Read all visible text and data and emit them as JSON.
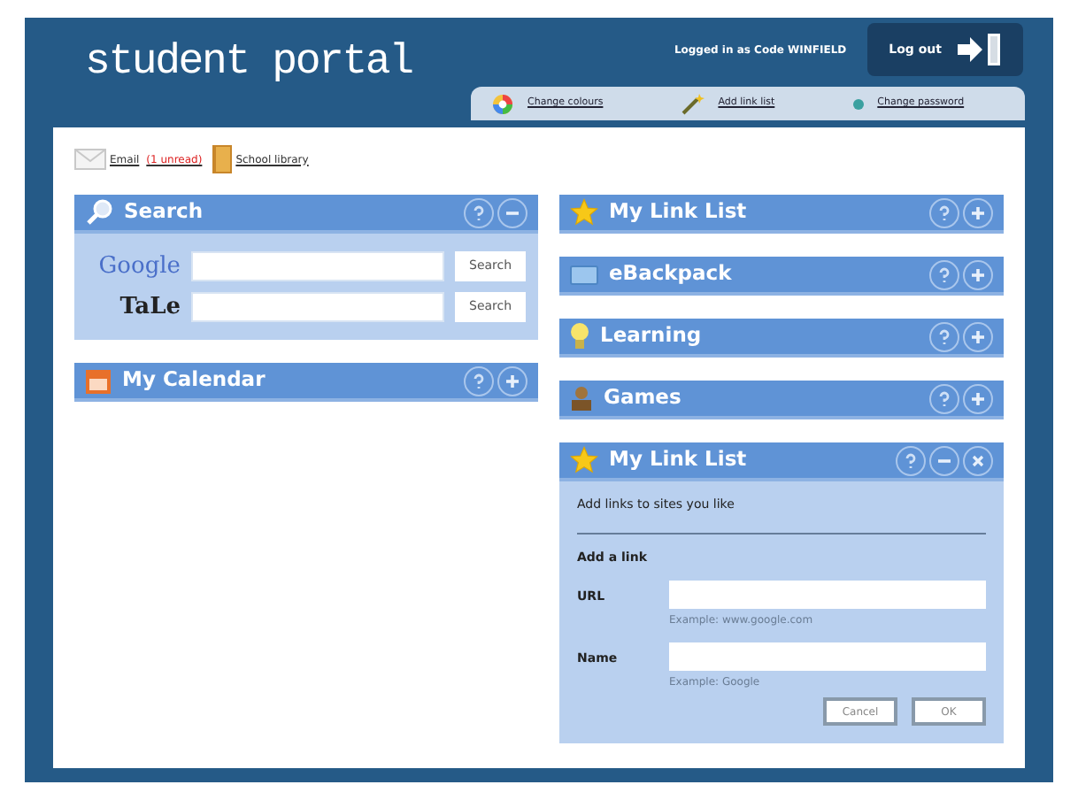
{
  "header": {
    "title": "student portal",
    "logged_in": "Logged in as Code WINFIELD",
    "logout": "Log out"
  },
  "tabs": [
    {
      "label": "Change colours"
    },
    {
      "label": "Add link list"
    },
    {
      "label": "Change password"
    }
  ],
  "quick_links": [
    {
      "label": "Email",
      "badge": "(1 unread)"
    },
    {
      "label": "School library"
    }
  ],
  "left_column": [
    {
      "kind": "search",
      "title": "Search",
      "expanded": true,
      "engines": [
        {
          "logo": "Google",
          "button": "Search"
        },
        {
          "logo": "TaLe",
          "button": "Search"
        }
      ]
    },
    {
      "kind": "calendar",
      "title": "My Calendar",
      "expanded": false
    }
  ],
  "right_column": [
    {
      "kind": "linklist",
      "title": "My Link List",
      "expanded": false
    },
    {
      "kind": "backpack",
      "title": "eBackpack",
      "expanded": false
    },
    {
      "kind": "learning",
      "title": "Learning",
      "expanded": false
    },
    {
      "kind": "games",
      "title": "Games",
      "expanded": false
    },
    {
      "kind": "linkform",
      "title": "My Link List",
      "expanded": true,
      "intro": "Add links to sites you like",
      "form_title": "Add a link",
      "fields": [
        {
          "label": "URL",
          "hint": "Example: www.google.com"
        },
        {
          "label": "Name",
          "hint": "Example: Google"
        }
      ],
      "buttons": [
        "Cancel",
        "OK"
      ]
    }
  ]
}
